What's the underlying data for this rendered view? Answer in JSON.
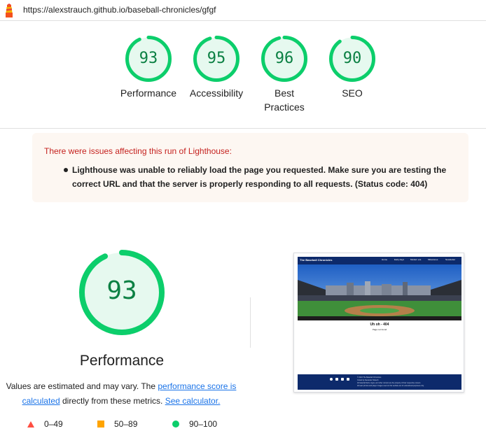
{
  "url_bar": {
    "url": "https://alexstrauch.github.io/baseball-chronicles/gfgf"
  },
  "categories": [
    {
      "name": "performance",
      "score": "93",
      "label": "Performance"
    },
    {
      "name": "accessibility",
      "score": "95",
      "label": "Accessibility"
    },
    {
      "name": "best-practices",
      "score": "96",
      "label": "Best Practices"
    },
    {
      "name": "seo",
      "score": "90",
      "label": "SEO"
    }
  ],
  "warning": {
    "title": "There were issues affecting this run of Lighthouse:",
    "message": "Lighthouse was unable to reliably load the page you requested. Make sure you are testing the correct URL and that the server is properly responding to all requests. (Status code: 404)"
  },
  "performance": {
    "score": "93",
    "title": "Performance",
    "desc_prefix": "Values are estimated and may vary. The ",
    "score_link": "performance score is calculated",
    "desc_middle": " directly from these metrics. ",
    "calc_link": "See calculator."
  },
  "legend": [
    {
      "range": "0–49",
      "color": "#ff4e42",
      "shape": "triangle"
    },
    {
      "range": "50–89",
      "color": "#ffa400",
      "shape": "square"
    },
    {
      "range": "90–100",
      "color": "#0cce6b",
      "shape": "circle"
    }
  ],
  "colors": {
    "pass": "#0cce6b",
    "pass_text": "#0b8043",
    "pass_bg": "#e6f9ef",
    "warning_text": "#c5221f",
    "link": "#1a73e8"
  },
  "thumbnail": {
    "brand": "The Baseball Chronicles",
    "nav": [
      "Home",
      "Early days",
      "Modern era",
      "Milestones",
      "Newsletter"
    ],
    "heading": "Uh oh - 404",
    "subheading": "Page not found",
    "footer_lines": [
      "© 2024 The Baseball Chronicles",
      "Coded by Alexander Strauch",
      "All baseball facts, logos, and other content are the property of their respective owners.",
      "All team photos and player images used on this website are for educational purposes only."
    ]
  }
}
